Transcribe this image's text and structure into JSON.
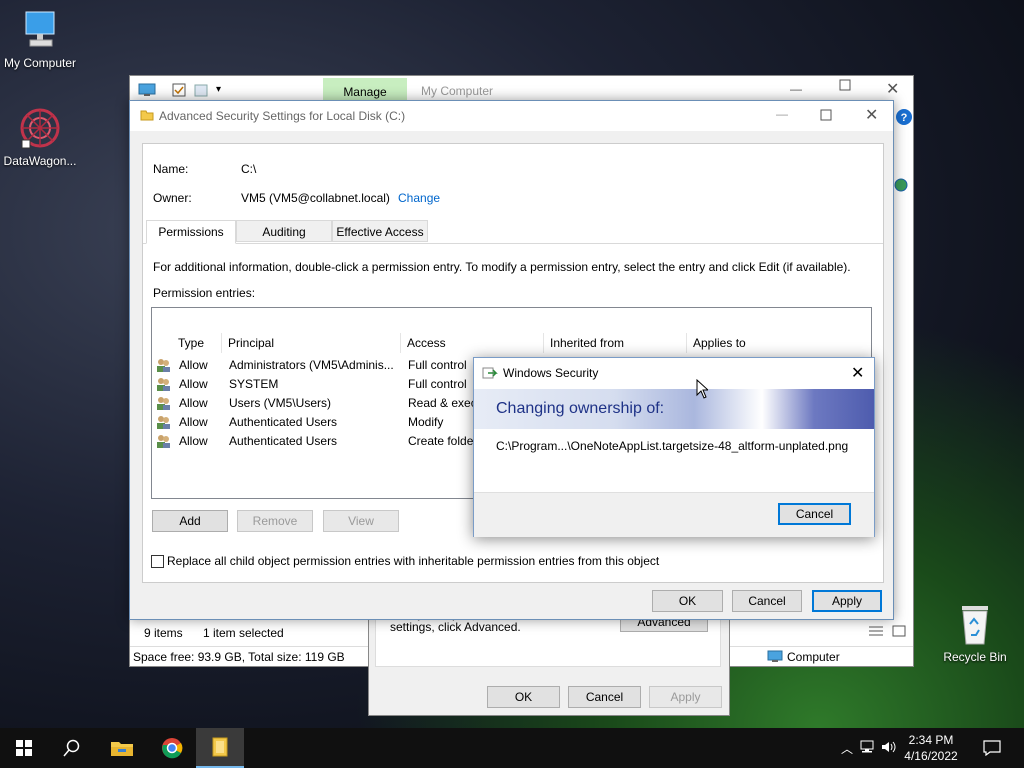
{
  "desktop": {
    "icons": [
      {
        "label": "My Computer"
      },
      {
        "label": "DataWagon..."
      },
      {
        "label": "Recycle Bin"
      }
    ]
  },
  "explorer": {
    "title": "My Computer",
    "manage_tab": "Manage",
    "status_items": "9 items",
    "status_selected": "1 item selected",
    "space_info": "Space free: 93.9 GB, Total size: 119 GB",
    "location": "Computer"
  },
  "properties": {
    "hint": "For special permissions or advanced settings, click Advanced.",
    "advanced_button": "Advanced",
    "ok": "OK",
    "cancel": "Cancel",
    "apply": "Apply"
  },
  "advanced_security": {
    "title": "Advanced Security Settings for Local Disk (C:)",
    "name_label": "Name:",
    "name_value": "C:\\",
    "owner_label": "Owner:",
    "owner_value": "VM5 (VM5@collabnet.local)",
    "change_link": "Change",
    "tabs": [
      "Permissions",
      "Auditing",
      "Effective Access"
    ],
    "info_text": "For additional information, double-click a permission entry. To modify a permission entry, select the entry and click Edit (if available).",
    "entries_label": "Permission entries:",
    "columns": [
      "Type",
      "Principal",
      "Access",
      "Inherited from",
      "Applies to"
    ],
    "rows": [
      {
        "type": "Allow",
        "principal": "Administrators (VM5\\Adminis...",
        "access": "Full control"
      },
      {
        "type": "Allow",
        "principal": "SYSTEM",
        "access": "Full control"
      },
      {
        "type": "Allow",
        "principal": "Users (VM5\\Users)",
        "access": "Read & exec"
      },
      {
        "type": "Allow",
        "principal": "Authenticated Users",
        "access": "Modify"
      },
      {
        "type": "Allow",
        "principal": "Authenticated Users",
        "access": "Create folder"
      }
    ],
    "add": "Add",
    "remove": "Remove",
    "view": "View",
    "replace_checkbox": "Replace all child object permission entries with inheritable permission entries from this object",
    "ok": "OK",
    "cancel": "Cancel",
    "apply": "Apply"
  },
  "windows_security": {
    "title": "Windows Security",
    "heading": "Changing ownership of:",
    "path": "C:\\Program...\\OneNoteAppList.targetsize-48_altform-unplated.png",
    "cancel": "Cancel"
  },
  "taskbar": {
    "time": "2:34 PM",
    "date": "4/16/2022"
  }
}
